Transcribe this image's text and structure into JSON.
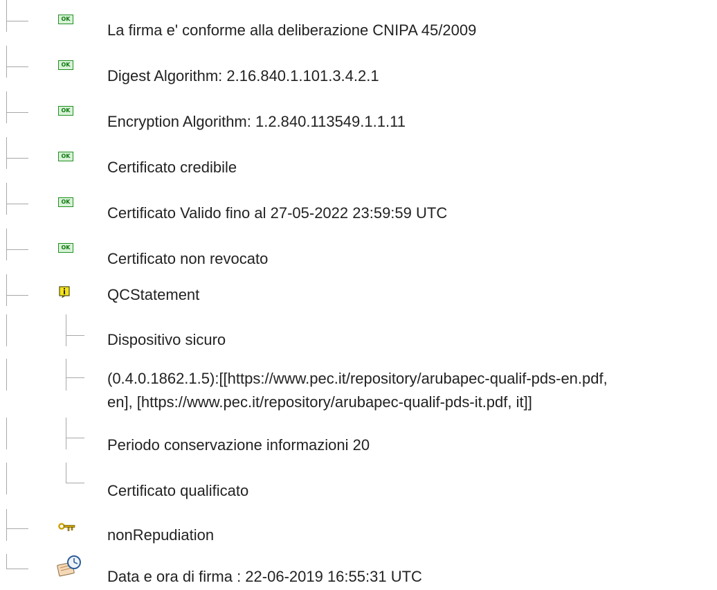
{
  "tree": {
    "checks": [
      {
        "icon": "ok-icon",
        "label": "La firma e' conforme alla deliberazione CNIPA 45/2009"
      },
      {
        "icon": "ok-icon",
        "label": "Digest Algorithm: 2.16.840.1.101.3.4.2.1"
      },
      {
        "icon": "ok-icon",
        "label": "Encryption Algorithm: 1.2.840.113549.1.1.11"
      },
      {
        "icon": "ok-icon",
        "label": "Certificato credibile"
      },
      {
        "icon": "ok-icon",
        "label": "Certificato Valido fino al 27-05-2022 23:59:59 UTC"
      },
      {
        "icon": "ok-icon",
        "label": "Certificato non revocato"
      }
    ],
    "qcstatement": {
      "icon": "info-icon",
      "label": "QCStatement",
      "children": [
        {
          "label": "Dispositivo sicuro"
        },
        {
          "label_line1": "(0.4.0.1862.1.5):[[https://www.pec.it/repository/arubapec-qualif-pds-en.pdf,",
          "label_line2": "en], [https://www.pec.it/repository/arubapec-qualif-pds-it.pdf, it]]"
        },
        {
          "label": "Periodo conservazione informazioni 20"
        },
        {
          "label": "Certificato qualificato"
        }
      ]
    },
    "non_repudiation": {
      "icon": "key-icon",
      "label": "nonRepudiation"
    },
    "signing_time": {
      "icon": "clock-icon",
      "label": "Data e ora di firma : 22-06-2019 16:55:31 UTC"
    }
  },
  "colors": {
    "ok_border": "#1f8f1f",
    "ok_fill": "#d8f2d8",
    "info_fill": "#f4e21a",
    "tree_line": "#a8a8a8"
  }
}
